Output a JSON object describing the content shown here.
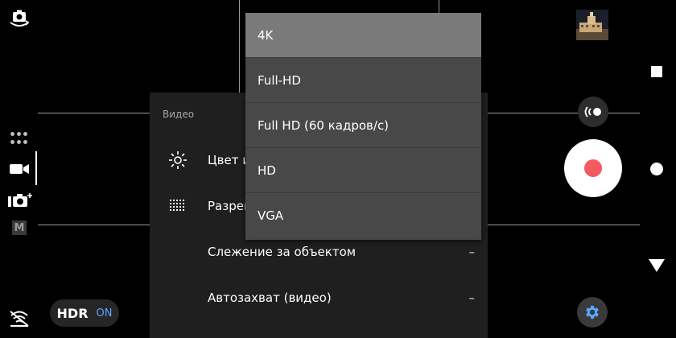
{
  "panel": {
    "section_title": "Видео",
    "rows": [
      {
        "label": "Цвет и",
        "value": ""
      },
      {
        "label": "Разреш",
        "value": ""
      },
      {
        "label": "Слежение за объектом",
        "value": "–"
      },
      {
        "label": "Автозахват (видео)",
        "value": "–"
      }
    ]
  },
  "dropdown": {
    "options": [
      "4K",
      "Full-HD",
      "Full HD (60 кадров/с)",
      "HD",
      "VGA"
    ],
    "selected": "4K"
  },
  "hdr": {
    "label": "HDR",
    "state": "ON"
  },
  "left_modes": {
    "manual_label": "M"
  },
  "colors": {
    "accent": "#5aa7ff",
    "record": "#f25b62",
    "panel": "#1f1f1f",
    "dropdown": "#484848",
    "selected": "#7a7a7a"
  },
  "icons": [
    "switch-camera-icon",
    "modes-grid-icon",
    "video-camera-icon",
    "photo-camera-plus-icon",
    "manual-mode-icon",
    "flash-off-icon",
    "brightness-icon",
    "resolution-grid-icon",
    "sideband-icon",
    "record-icon",
    "gear-icon"
  ]
}
